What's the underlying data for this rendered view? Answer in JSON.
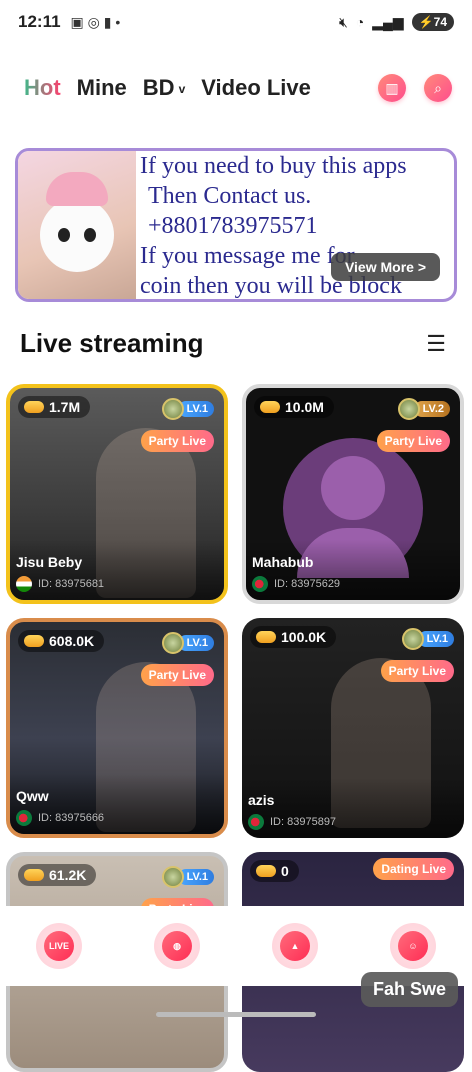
{
  "status_bar": {
    "time": "12:11",
    "battery": "74"
  },
  "top_nav": {
    "tabs": [
      {
        "label": "Hot",
        "active": true
      },
      {
        "label": "Mine"
      },
      {
        "label": "BD"
      },
      {
        "label": "Video Live"
      }
    ],
    "icons": [
      "ranking-icon",
      "search-icon"
    ]
  },
  "banner": {
    "line1": "If you need to buy this apps",
    "line2": "Then Contact us.",
    "line3": "+8801783975571",
    "line4": "If you message me for",
    "line5": "coin then you will be block",
    "view_more": "View More >"
  },
  "section": {
    "title": "Live streaming"
  },
  "streams": [
    {
      "coins": "1.7M",
      "level": "LV.1",
      "badge": "Party Live",
      "name": "Jisu Beby",
      "id": "ID: 83975681",
      "flag": "in"
    },
    {
      "coins": "10.0M",
      "level": "LV.2",
      "badge": "Party Live",
      "name": "Mahabub",
      "id": "ID: 83975629",
      "flag": "bd"
    },
    {
      "coins": "608.0K",
      "level": "LV.1",
      "badge": "Party Live",
      "name": "Qww",
      "id": "ID: 83975666",
      "flag": "bd"
    },
    {
      "coins": "100.0K",
      "level": "LV.1",
      "badge": "Party Live",
      "name": "azis",
      "id": "ID: 83975897",
      "flag": "bd"
    },
    {
      "coins": "61.2K",
      "level": "LV.1",
      "badge": "Party Live",
      "name": "",
      "id": "",
      "flag": "bd"
    },
    {
      "coins": "0",
      "level": "",
      "badge": "Dating Live",
      "name": "",
      "id": "",
      "flag": "bd"
    }
  ],
  "bottom_nav": {
    "items": [
      {
        "label": "LIVE",
        "icon": "live-tv-icon"
      },
      {
        "label": "",
        "icon": "planet-icon"
      },
      {
        "label": "",
        "icon": "bell-icon"
      },
      {
        "label": "",
        "icon": "smile-icon"
      }
    ]
  },
  "toast": "Fah Swe"
}
